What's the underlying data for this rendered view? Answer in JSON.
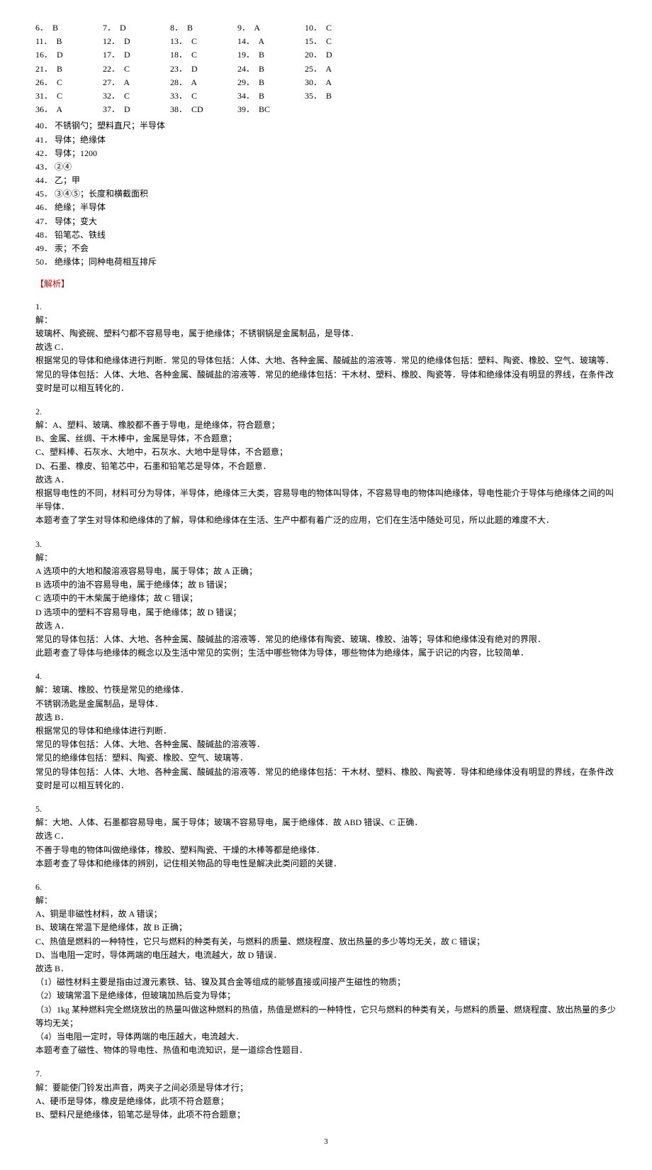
{
  "answers_grid": [
    [
      {
        "n": "6．",
        "a": "B"
      },
      {
        "n": "7．",
        "a": "D"
      },
      {
        "n": "8．",
        "a": "B"
      },
      {
        "n": "9．",
        "a": "A"
      },
      {
        "n": "10．",
        "a": "C"
      }
    ],
    [
      {
        "n": "11．",
        "a": "B"
      },
      {
        "n": "12．",
        "a": "D"
      },
      {
        "n": "13．",
        "a": "C"
      },
      {
        "n": "14．",
        "a": "A"
      },
      {
        "n": "15．",
        "a": "C"
      }
    ],
    [
      {
        "n": "16．",
        "a": "D"
      },
      {
        "n": "17．",
        "a": "D"
      },
      {
        "n": "18．",
        "a": "C"
      },
      {
        "n": "19．",
        "a": "B"
      },
      {
        "n": "20．",
        "a": "D"
      }
    ],
    [
      {
        "n": "21．",
        "a": "B"
      },
      {
        "n": "22．",
        "a": "C"
      },
      {
        "n": "23．",
        "a": "D"
      },
      {
        "n": "24．",
        "a": "B"
      },
      {
        "n": "25．",
        "a": "A"
      }
    ],
    [
      {
        "n": "26．",
        "a": "C"
      },
      {
        "n": "27．",
        "a": "A"
      },
      {
        "n": "28．",
        "a": "A"
      },
      {
        "n": "29．",
        "a": "B"
      },
      {
        "n": "30．",
        "a": "A"
      }
    ],
    [
      {
        "n": "31．",
        "a": "C"
      },
      {
        "n": "32．",
        "a": "C"
      },
      {
        "n": "33．",
        "a": "C"
      },
      {
        "n": "34．",
        "a": "B"
      },
      {
        "n": "35．",
        "a": "B"
      }
    ],
    [
      {
        "n": "36．",
        "a": "A"
      },
      {
        "n": "37．",
        "a": "D"
      },
      {
        "n": "38．",
        "a": "CD"
      },
      {
        "n": "39．",
        "a": "BC"
      }
    ]
  ],
  "fill_answers": [
    "40．  不锈钢勺；塑料直尺；半导体",
    "41．  导体；绝缘体",
    "42．  导体；1200",
    "43．  ②④",
    "44．  乙；甲",
    "45．  ③④⑤；长度和横截面积",
    "46．  绝缘；半导体",
    "47．  导体；变大",
    "48．  铅笔芯、铁线",
    "49．  汞；不会",
    "50．  绝缘体；同种电荷相互排斥"
  ],
  "section_title": "【解析】",
  "explanations": [
    {
      "num": "1.",
      "lines": [
        "解：",
        "玻璃杯、陶瓷碗、塑料勺都不容易导电，属于绝缘体；不锈钢锅是金属制品，是导体．",
        "故选 C．",
        "根据常见的导体和绝缘体进行判断．常见的导体包括：人体、大地、各种金属、酸碱盐的溶液等．常见的绝缘体包括：塑料、陶瓷、橡胶、空气、玻璃等．",
        "常见的导体包括：人体、大地、各种金属、酸碱盐的溶液等．常见的绝缘体包括：干木材、塑料、橡胶、陶瓷等．导体和绝缘体没有明显的界线，在条件改变时是可以相互转化的．"
      ]
    },
    {
      "num": "2.",
      "lines": [
        "解：A、塑料、玻璃、橡胶都不善于导电，是绝缘体，符合题意；",
        "B、金属、丝绸、干木棒中，金属是导体，不合题意；",
        "C、塑料棒、石灰水、大地中，石灰水、大地中是导体，不合题意；",
        "D、石墨、橡皮、铅笔芯中，石墨和铅笔芯是导体，不合题意．",
        "故选 A．",
        "根据导电性的不同，材料可分为导体，半导体，绝缘体三大类，容易导电的物体叫导体，不容易导电的物体叫绝缘体，导电性能介于导体与绝缘体之间的叫半导体．",
        "本题考查了学生对导体和绝缘体的了解，导体和绝缘体在生活、生产中都有着广泛的应用，它们在生活中随处可见，所以此题的难度不大．"
      ]
    },
    {
      "num": "3.",
      "lines": [
        "解：",
        "A 选项中的大地和酸溶液容易导电，属于导体；故 A 正确；",
        "B 选项中的油不容易导电，属于绝缘体；故 B 错误；",
        "C 选项中的干木柴属于绝缘体；故 C 错误；",
        "D 选项中的塑料不容易导电，属于绝缘体；故 D 错误；",
        "故选 A．",
        "常见的导体包括：人体、大地、各种金属、酸碱盐的溶液等．常见的绝缘体有陶瓷、玻璃、橡胶、油等；导体和绝缘体没有绝对的界限．",
        "此题考查了导体与绝缘体的概念以及生活中常见的实例；生活中哪些物体为导体，哪些物体为绝缘体，属于识记的内容，比较简单．"
      ]
    },
    {
      "num": "4.",
      "lines": [
        "解：玻璃、橡胶、竹筷是常见的绝缘体．",
        "不锈钢汤匙是金属制品，是导体．",
        "故选 B．",
        "根据常见的导体和绝缘体进行判断．",
        "常见的导体包括：人体、大地、各种金属、酸碱盐的溶液等．",
        "常见的绝缘体包括：塑料、陶瓷、橡胶、空气、玻璃等．",
        "常见的导体包括：人体、大地、各种金属、酸碱盐的溶液等．常见的绝缘体包括：干木材、塑料、橡胶、陶瓷等．导体和绝缘体没有明显的界线，在条件改变时是可以相互转化的．"
      ]
    },
    {
      "num": "5.",
      "lines": [
        "解：大地、人体、石墨都容易导电，属于导体；玻璃不容易导电，属于绝缘体．故 ABD 错误、C 正确．",
        "故选 C．",
        "不善于导电的物体叫做绝缘体，橡胶、塑料陶瓷、干燥的木棒等都是绝缘体．",
        "本题考查了导体和绝缘体的辨别，记住相关物品的导电性是解决此类问题的关键．"
      ]
    },
    {
      "num": "6.",
      "lines": [
        "解：",
        "A、铜是非磁性材料，故 A 错误；",
        "B、玻璃在常温下是绝缘体，故 B 正确；",
        "C、热值是燃料的一种特性，它只与燃料的种类有关，与燃料的质量、燃烧程度、放出热量的多少等均无关，故 C 错误；",
        "D、当电阻一定时，导体两端的电压越大，电流越大，故 D 错误．",
        "故选 B．",
        "（1）磁性材料主要是指由过渡元素铁、钴、镍及其合金等组成的能够直接或间接产生磁性的物质；",
        "（2）玻璃常温下是绝缘体，但玻璃加热后变为导体；",
        "（3）1kg 某种燃料完全燃烧放出的热量叫做这种燃料的热值，热值是燃料的一种特性，它只与燃料的种类有关，与燃料的质量、燃烧程度、放出热量的多少等均无关；",
        "（4）当电阻一定时，导体两端的电压越大，电流越大．",
        "本题考查了磁性、物体的导电性、热值和电流知识，是一道综合性题目．"
      ]
    },
    {
      "num": "7.",
      "lines": [
        "解：要能使门铃发出声音，两夹子之间必须是导体才行；",
        "A、硬币是导体，橡皮是绝缘体，此项不符合题意；",
        "B、塑料尺是绝缘体，铅笔芯是导体，此项不符合题意；"
      ]
    }
  ],
  "page_number": "3"
}
